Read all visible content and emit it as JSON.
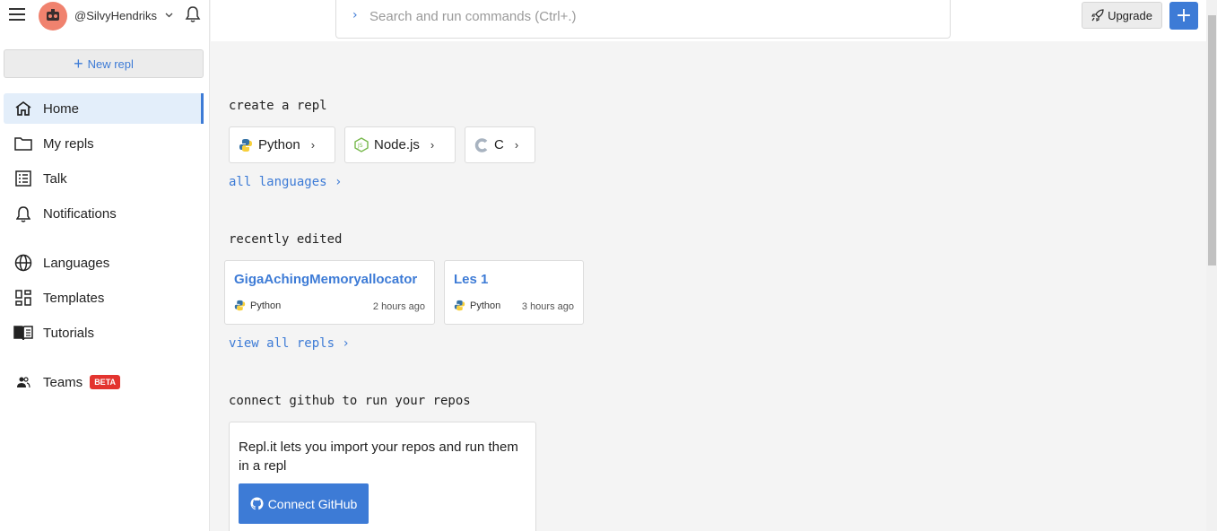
{
  "user": {
    "username": "@SilvyHendriks"
  },
  "sidebar": {
    "new_repl_label": "New repl",
    "items": [
      {
        "label": "Home",
        "icon": "home-icon",
        "active": true
      },
      {
        "label": "My repls",
        "icon": "folder-icon"
      },
      {
        "label": "Talk",
        "icon": "list-icon"
      },
      {
        "label": "Notifications",
        "icon": "bell-icon"
      },
      {
        "label": "Languages",
        "icon": "globe-icon"
      },
      {
        "label": "Templates",
        "icon": "grid-icon"
      },
      {
        "label": "Tutorials",
        "icon": "book-icon"
      },
      {
        "label": "Teams",
        "icon": "people-icon",
        "badge": "BETA"
      }
    ]
  },
  "search": {
    "placeholder": "Search and run commands (Ctrl+.)"
  },
  "topbar": {
    "upgrade_label": "Upgrade",
    "add_label": "+"
  },
  "create": {
    "heading": "create a repl",
    "languages": [
      {
        "name": "Python",
        "icon": "python-icon"
      },
      {
        "name": "Node.js",
        "icon": "nodejs-icon"
      },
      {
        "name": "C",
        "icon": "c-icon"
      }
    ],
    "all_languages_link": "all languages ›"
  },
  "recent": {
    "heading": "recently edited",
    "repls": [
      {
        "title": "GigaAchingMemoryallocator",
        "language": "Python",
        "time": "2 hours ago"
      },
      {
        "title": "Les 1",
        "language": "Python",
        "time": "3 hours ago"
      }
    ],
    "view_all_link": "view all repls ›"
  },
  "github": {
    "heading": "connect github to run your repos",
    "text": "Repl.it lets you import your repos and run them in a repl",
    "button_label": "Connect GitHub"
  },
  "colors": {
    "accent": "#3d7bd6",
    "badge": "#e3342f",
    "avatar": "#f0826e"
  }
}
